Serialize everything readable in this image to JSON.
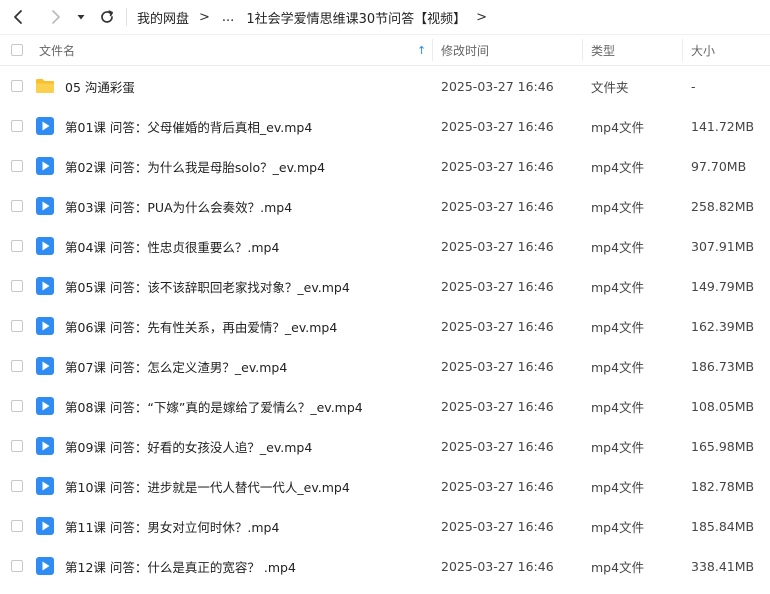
{
  "nav": {
    "breadcrumb_root": "我的网盘",
    "breadcrumb_ellipsis": "...",
    "breadcrumb_current": "1社会学爱情思维课30节问答【视频】"
  },
  "columns": {
    "name": "文件名",
    "modified": "修改时间",
    "type": "类型",
    "size": "大小"
  },
  "files": [
    {
      "name": "05 沟通彩蛋",
      "date": "2025-03-27 16:46",
      "type": "文件夹",
      "size": "-",
      "icon": "folder-icon"
    },
    {
      "name": "第01课 问答：父母催婚的背后真相_ev.mp4",
      "date": "2025-03-27 16:46",
      "type": "mp4文件",
      "size": "141.72MB",
      "icon": "video-file-icon"
    },
    {
      "name": "第02课 问答：为什么我是母胎solo？_ev.mp4",
      "date": "2025-03-27 16:46",
      "type": "mp4文件",
      "size": "97.70MB",
      "icon": "video-file-icon"
    },
    {
      "name": "第03课 问答：PUA为什么会奏效？.mp4",
      "date": "2025-03-27 16:46",
      "type": "mp4文件",
      "size": "258.82MB",
      "icon": "video-file-icon"
    },
    {
      "name": "第04课 问答：性忠贞很重要么？.mp4",
      "date": "2025-03-27 16:46",
      "type": "mp4文件",
      "size": "307.91MB",
      "icon": "video-file-icon"
    },
    {
      "name": "第05课 问答：该不该辞职回老家找对象？_ev.mp4",
      "date": "2025-03-27 16:46",
      "type": "mp4文件",
      "size": "149.79MB",
      "icon": "video-file-icon"
    },
    {
      "name": "第06课 问答：先有性关系，再由爱情？_ev.mp4",
      "date": "2025-03-27 16:46",
      "type": "mp4文件",
      "size": "162.39MB",
      "icon": "video-file-icon"
    },
    {
      "name": "第07课 问答：怎么定义渣男？_ev.mp4",
      "date": "2025-03-27 16:46",
      "type": "mp4文件",
      "size": "186.73MB",
      "icon": "video-file-icon"
    },
    {
      "name": "第08课 问答：“下嫁”真的是嫁给了爱情么？_ev.mp4",
      "date": "2025-03-27 16:46",
      "type": "mp4文件",
      "size": "108.05MB",
      "icon": "video-file-icon"
    },
    {
      "name": "第09课 问答：好看的女孩没人追？_ev.mp4",
      "date": "2025-03-27 16:46",
      "type": "mp4文件",
      "size": "165.98MB",
      "icon": "video-file-icon"
    },
    {
      "name": "第10课 问答：进步就是一代人替代一代人_ev.mp4",
      "date": "2025-03-27 16:46",
      "type": "mp4文件",
      "size": "182.78MB",
      "icon": "video-file-icon"
    },
    {
      "name": "第11课 问答：男女对立何时休？.mp4",
      "date": "2025-03-27 16:46",
      "type": "mp4文件",
      "size": "185.84MB",
      "icon": "video-file-icon"
    },
    {
      "name": "第12课 问答：什么是真正的宽容？ .mp4",
      "date": "2025-03-27 16:46",
      "type": "mp4文件",
      "size": "338.41MB",
      "icon": "video-file-icon"
    }
  ],
  "colors": {
    "accent": "#1f8ef1",
    "folder": "#f9c02b",
    "video": "#2f8cf2"
  }
}
